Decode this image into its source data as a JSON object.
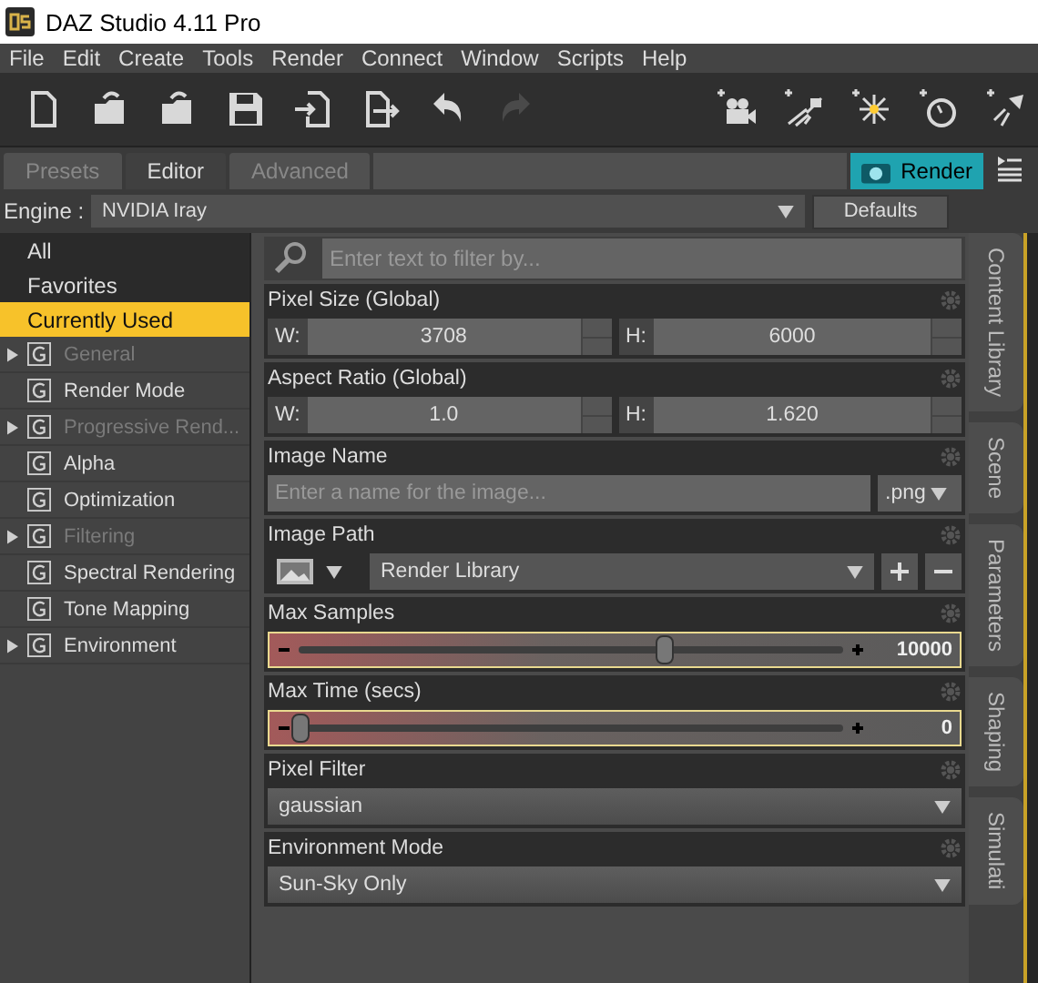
{
  "window": {
    "title": "DAZ Studio 4.11 Pro"
  },
  "menu": [
    "File",
    "Edit",
    "Create",
    "Tools",
    "Render",
    "Connect",
    "Window",
    "Scripts",
    "Help"
  ],
  "toolbar": {
    "left": [
      {
        "kind": "new",
        "disabled": false
      },
      {
        "kind": "open",
        "disabled": false
      },
      {
        "kind": "merge",
        "disabled": false
      },
      {
        "kind": "save",
        "disabled": false
      },
      {
        "kind": "import",
        "disabled": false
      },
      {
        "kind": "export",
        "disabled": false
      },
      {
        "kind": "undo",
        "disabled": false
      },
      {
        "kind": "redo",
        "disabled": true
      }
    ],
    "right": [
      {
        "kind": "camera"
      },
      {
        "kind": "spot"
      },
      {
        "kind": "point"
      },
      {
        "kind": "distant"
      },
      {
        "kind": "lamp"
      }
    ]
  },
  "tabs": [
    {
      "label": "Presets",
      "selected": false
    },
    {
      "label": "Editor",
      "selected": true
    },
    {
      "label": "Advanced",
      "selected": false
    }
  ],
  "render_button": "Render",
  "engine": {
    "label": "Engine :",
    "value": "NVIDIA Iray",
    "defaults_button": "Defaults"
  },
  "sidebar": {
    "items": [
      {
        "kind": "filter",
        "label": "All",
        "selected": false,
        "expandable": false,
        "disabled": false
      },
      {
        "kind": "filter",
        "label": "Favorites",
        "selected": false,
        "expandable": false,
        "disabled": false
      },
      {
        "kind": "filter",
        "label": "Currently Used",
        "selected": true,
        "expandable": false,
        "disabled": false
      },
      {
        "kind": "group",
        "label": "General",
        "selected": false,
        "expandable": true,
        "disabled": true
      },
      {
        "kind": "group",
        "label": "Render Mode",
        "selected": false,
        "expandable": false,
        "disabled": false
      },
      {
        "kind": "group",
        "label": "Progressive Rend...",
        "selected": false,
        "expandable": true,
        "disabled": true
      },
      {
        "kind": "group",
        "label": "Alpha",
        "selected": false,
        "expandable": false,
        "disabled": false
      },
      {
        "kind": "group",
        "label": "Optimization",
        "selected": false,
        "expandable": false,
        "disabled": false
      },
      {
        "kind": "group",
        "label": "Filtering",
        "selected": false,
        "expandable": true,
        "disabled": true
      },
      {
        "kind": "group",
        "label": "Spectral Rendering",
        "selected": false,
        "expandable": false,
        "disabled": false
      },
      {
        "kind": "group",
        "label": "Tone Mapping",
        "selected": false,
        "expandable": false,
        "disabled": false
      },
      {
        "kind": "group",
        "label": "Environment",
        "selected": false,
        "expandable": true,
        "disabled": false
      }
    ]
  },
  "filter": {
    "placeholder": "Enter text to filter by..."
  },
  "parameters": [
    {
      "kind": "pair",
      "name": "Pixel Size (Global)",
      "w_label": "W:",
      "w_value": "3708",
      "h_label": "H:",
      "h_value": "6000"
    },
    {
      "kind": "pair",
      "name": "Aspect Ratio (Global)",
      "w_label": "W:",
      "w_value": "1.0",
      "h_label": "H:",
      "h_value": "1.620"
    },
    {
      "kind": "name",
      "name": "Image Name",
      "placeholder": "Enter a name for the image...",
      "format": ".png"
    },
    {
      "kind": "path",
      "name": "Image Path",
      "value": "Render Library"
    },
    {
      "kind": "slider",
      "name": "Max Samples",
      "level": 0.67,
      "reading": "10000"
    },
    {
      "kind": "slider",
      "name": "Max Time (secs)",
      "level": 0,
      "reading": "0"
    },
    {
      "kind": "dropdown",
      "name": "Pixel Filter",
      "value": "gaussian"
    },
    {
      "kind": "dropdown",
      "name": "Environment Mode",
      "value": "Sun-Sky Only"
    }
  ],
  "side_tabs": [
    "Content Library",
    "Scene",
    "Parameters",
    "Shaping",
    "Simulati"
  ]
}
